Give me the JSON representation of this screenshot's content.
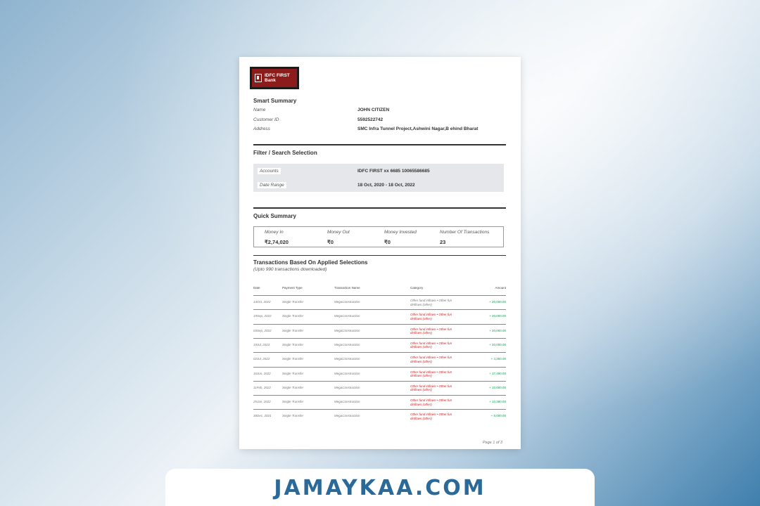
{
  "logo": {
    "line1": "IDFC FIRST",
    "line2": "Bank"
  },
  "smart_summary": {
    "title": "Smart Summary",
    "name_label": "Name",
    "name_value": "JOHN CITIZEN",
    "customer_label": "Customer ID",
    "customer_value": "5592522742",
    "address_label": "Address",
    "address_value": "SMC Infra Tunnel Project,Ashwini Nagar,B ehind Bharat"
  },
  "filter": {
    "title": "Filter / Search Selection",
    "accounts_label": "Accounts",
    "accounts_value": "IDFC FIRST xx 6685 10065586685",
    "date_label": "Date Range",
    "date_value": "18 Oct, 2020 - 18 Oct, 2022"
  },
  "quick_summary": {
    "title": "Quick Summary",
    "money_in_label": "Money In",
    "money_in": "₹2,74,020",
    "money_out_label": "Money Out",
    "money_out": "₹0",
    "invested_label": "Money Invested",
    "invested": "₹0",
    "count_label": "Number Of Transactions",
    "count": "23"
  },
  "transactions": {
    "title": "Transactions Based On Applied Selections",
    "subtitle": "(Upto 990 transactions downloaded)",
    "headers": {
      "date": "Date",
      "payment": "Payment Type",
      "name": "Transaction Name",
      "category": "Category",
      "amount": "Amount"
    },
    "rows": [
      {
        "date": "13Oct, 2022",
        "payment": "Single Transfer",
        "name": "MegaConstruction",
        "category": "Other fund inflows • Other fun dinflows (other)",
        "amount": "+ 20,000.00"
      },
      {
        "date": "19Sep, 2022",
        "payment": "Single Transfer",
        "name": "MegaConstruction",
        "category": "Other fund inflows • Other fun dinflows (other)",
        "amount": "+ 20,000.00"
      },
      {
        "date": "03Sep, 2022",
        "payment": "Single Transfer",
        "name": "MegaConstruction",
        "category": "Other fund inflows • Other fun dinflows (other)",
        "amount": "+ 20,000.00"
      },
      {
        "date": "19Jul, 2022",
        "payment": "Single Transfer",
        "name": "MegaConstruction",
        "category": "Other fund inflows • Other fun dinflows (other)",
        "amount": "+ 20,000.00"
      },
      {
        "date": "02Jul, 2022",
        "payment": "Single Transfer",
        "name": "MegaConstruction",
        "category": "Other fund inflows • Other fun dinflows (other)",
        "amount": "+ 4,350.00"
      },
      {
        "date": "16Jun, 2022",
        "payment": "Single Transfer",
        "name": "MegaConstruction",
        "category": "Other fund inflows • Other fun dinflows (other)",
        "amount": "+ 17,490.00"
      },
      {
        "date": "11Feb, 2022",
        "payment": "Single Transfer",
        "name": "MegaConstruction",
        "category": "Other fund inflows • Other fun dinflows (other)",
        "amount": "+ 10,000.00"
      },
      {
        "date": "25Jan, 2022",
        "payment": "Single Transfer",
        "name": "MegaConstruction",
        "category": "Other fund inflows • Other fun dinflows (other)",
        "amount": "+ 10,380.00"
      },
      {
        "date": "30Dec, 2021",
        "payment": "Single Transfer",
        "name": "MegaConstruction",
        "category": "Other fund inflows • Other fun dinflows (other)",
        "amount": "+ 8,000.00"
      }
    ]
  },
  "page_number": "Page 1 of 3",
  "banner": {
    "text": "JAMAYKAA.COM"
  },
  "colors": {
    "brand_red": "#8c1c1c",
    "amount_green": "#1a9a55",
    "category_red": "#d8191a",
    "banner_blue": "#2b6a98"
  }
}
